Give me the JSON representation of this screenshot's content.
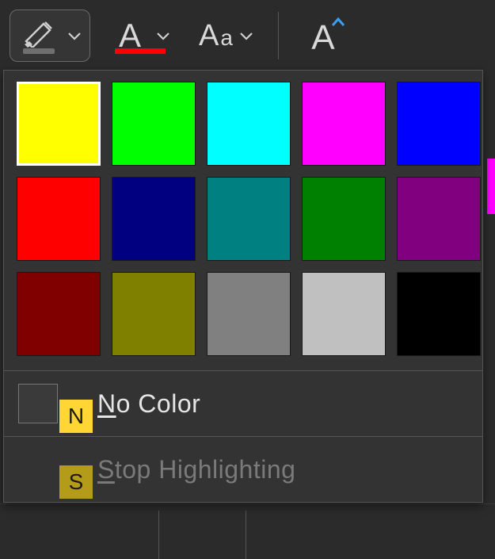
{
  "toolbar": {
    "highlighter": {
      "selected": true
    },
    "font_color_underline": "#ff0000"
  },
  "dropdown": {
    "swatches": [
      {
        "name": "yellow",
        "color": "#ffff00",
        "selected": true
      },
      {
        "name": "lime",
        "color": "#00ff00"
      },
      {
        "name": "cyan",
        "color": "#00ffff"
      },
      {
        "name": "magenta",
        "color": "#ff00ff"
      },
      {
        "name": "blue",
        "color": "#0000ff"
      },
      {
        "name": "red",
        "color": "#ff0000"
      },
      {
        "name": "navy",
        "color": "#000080"
      },
      {
        "name": "teal",
        "color": "#008080"
      },
      {
        "name": "green",
        "color": "#008000"
      },
      {
        "name": "purple",
        "color": "#800080"
      },
      {
        "name": "maroon",
        "color": "#800000"
      },
      {
        "name": "olive",
        "color": "#808000"
      },
      {
        "name": "gray",
        "color": "#808080"
      },
      {
        "name": "silver",
        "color": "#c0c0c0"
      },
      {
        "name": "black",
        "color": "#000000"
      }
    ],
    "no_color": {
      "label_pre": "",
      "label_ul": "N",
      "label_post": "o Color",
      "key": "N"
    },
    "stop_highlighting": {
      "label_pre": "",
      "label_ul": "S",
      "label_post": "top Highlighting",
      "key": "S",
      "disabled": true
    }
  }
}
